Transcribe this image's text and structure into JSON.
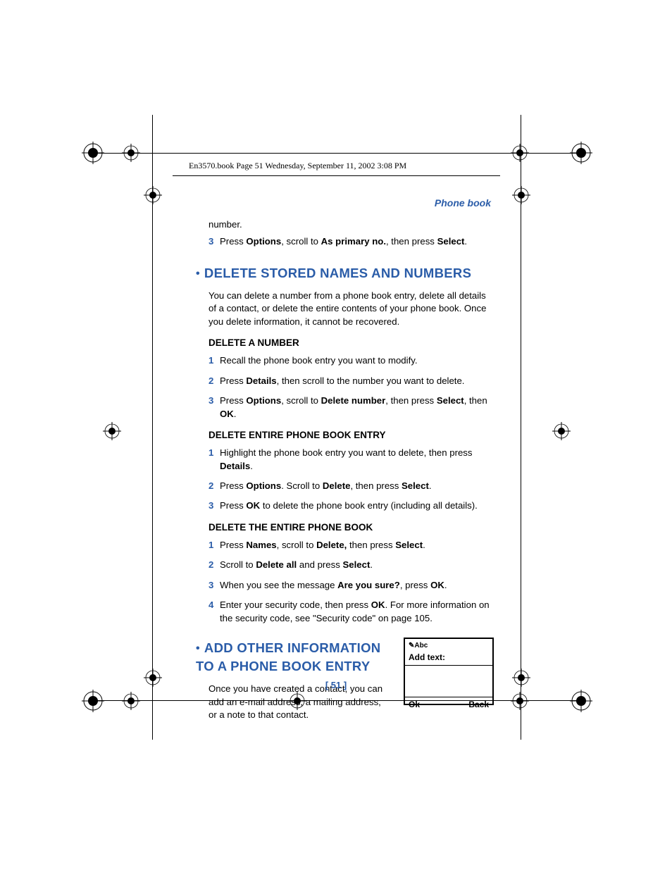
{
  "header_line": "En3570.book  Page 51  Wednesday, September 11, 2002  3:08 PM",
  "running_header": "Phone book",
  "top_carry": "number.",
  "step3_top": {
    "num": "3",
    "pre": "Press ",
    "b1": "Options",
    "m1": ", scroll to ",
    "b2": "As primary no.",
    "m2": ", then press ",
    "b3": "Select",
    "post": "."
  },
  "h1": "DELETE STORED NAMES AND NUMBERS",
  "h1_para": "You can delete a number from a phone book entry, delete all details of a contact, or delete the entire contents of your phone book. Once you delete information, it cannot be recovered.",
  "sub1": "DELETE A NUMBER",
  "s1_1": {
    "num": "1",
    "t": "Recall the phone book entry you want to modify."
  },
  "s1_2": {
    "num": "2",
    "pre": "Press ",
    "b1": "Details",
    "post": ", then scroll to the number you want to delete."
  },
  "s1_3": {
    "num": "3",
    "pre": "Press ",
    "b1": "Options",
    "m1": ", scroll to ",
    "b2": "Delete number",
    "m2": ", then press ",
    "b3": "Select",
    "m3": ", then ",
    "b4": "OK",
    "post": "."
  },
  "sub2": "DELETE ENTIRE PHONE BOOK ENTRY",
  "s2_1": {
    "num": "1",
    "pre": "Highlight the phone book entry you want to delete, then press ",
    "b1": "Details",
    "post": "."
  },
  "s2_2": {
    "num": "2",
    "pre": "Press ",
    "b1": "Options",
    "m1": ". Scroll to ",
    "b2": "Delete",
    "m2": ", then press ",
    "b3": "Select",
    "post": "."
  },
  "s2_3": {
    "num": "3",
    "pre": "Press ",
    "b1": "OK",
    "post": " to delete the phone book entry (including all details)."
  },
  "sub3": "DELETE THE ENTIRE PHONE BOOK",
  "s3_1": {
    "num": "1",
    "pre": "Press ",
    "b1": "Names",
    "m1": ", scroll to ",
    "b2": "Delete,",
    "m2": " then press ",
    "b3": "Select",
    "post": "."
  },
  "s3_2": {
    "num": "2",
    "pre": "Scroll to ",
    "b1": "Delete all",
    "m1": " and press ",
    "b2": "Select",
    "post": "."
  },
  "s3_3": {
    "num": "3",
    "pre": "When you see the message ",
    "b1": "Are you sure?",
    "m1": ", press ",
    "b2": "OK",
    "post": "."
  },
  "s3_4": {
    "num": "4",
    "pre": "Enter your security code, then press ",
    "b1": "OK",
    "post": ". For more information on the security code, see \"Security code\" on page 105."
  },
  "h2": "ADD OTHER INFORMATION TO A PHONE BOOK ENTRY",
  "h2_para": "Once you have created a contact, you can add an e-mail address, a mailing address, or a note to that contact.",
  "phone": {
    "mode": "✎Abc",
    "prompt": "Add text:",
    "ok": "Ok",
    "back": "Back"
  },
  "page_number": "[ 51 ]"
}
